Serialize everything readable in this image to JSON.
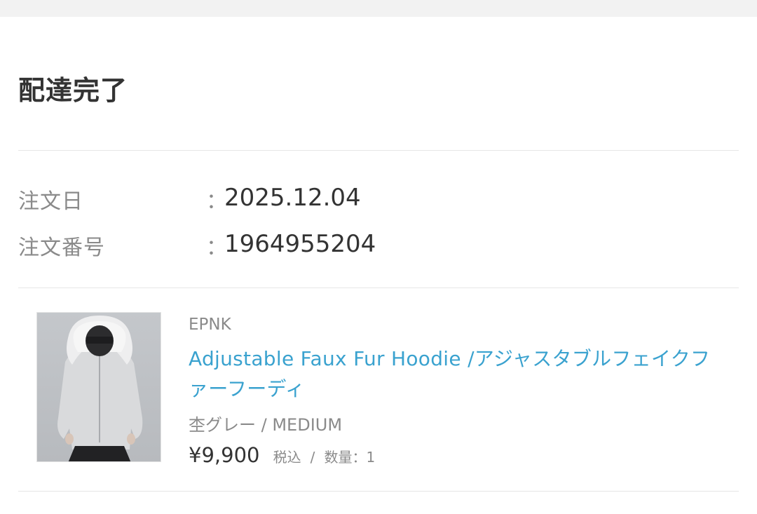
{
  "order": {
    "status": "配達完了",
    "date_label": "注文日",
    "date_value": "2025.12.04",
    "number_label": "注文番号",
    "number_value": "1964955204",
    "colon": "："
  },
  "item": {
    "brand": "EPNK",
    "name": "Adjustable Faux Fur Hoodie /アジャスタブルフェイクファーフーディ",
    "variant": "杢グレー / MEDIUM",
    "price": "¥9,900",
    "tax_label": "税込",
    "separator": "/",
    "quantity_label": "数量：",
    "quantity_value": "1"
  },
  "colors": {
    "link": "#3aa2cf",
    "text": "#333333",
    "muted": "#8a8a8a",
    "divider": "#e6e6e6"
  }
}
